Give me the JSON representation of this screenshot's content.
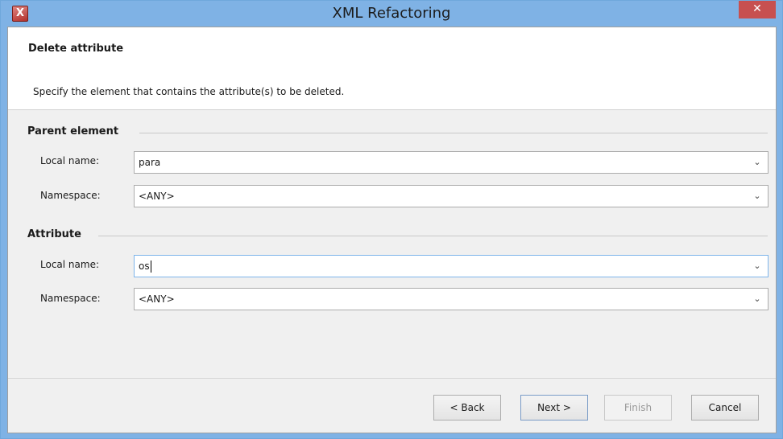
{
  "window": {
    "title": "XML Refactoring",
    "app_icon": "X",
    "close_label": "✕"
  },
  "header": {
    "title": "Delete attribute",
    "description": "Specify the element that contains the attribute(s) to be deleted."
  },
  "parent_element": {
    "group_title": "Parent element",
    "local_name_label": "Local name:",
    "local_name_value": "para",
    "namespace_label": "Namespace:",
    "namespace_value": "<ANY>"
  },
  "attribute": {
    "group_title": "Attribute",
    "local_name_label": "Local name:",
    "local_name_value": "os",
    "namespace_label": "Namespace:",
    "namespace_value": "<ANY>"
  },
  "buttons": {
    "back": "< Back",
    "next": "Next >",
    "finish": "Finish",
    "cancel": "Cancel"
  },
  "icons": {
    "dropdown": "chevron-down-icon",
    "close": "close-icon",
    "app": "app-icon"
  }
}
